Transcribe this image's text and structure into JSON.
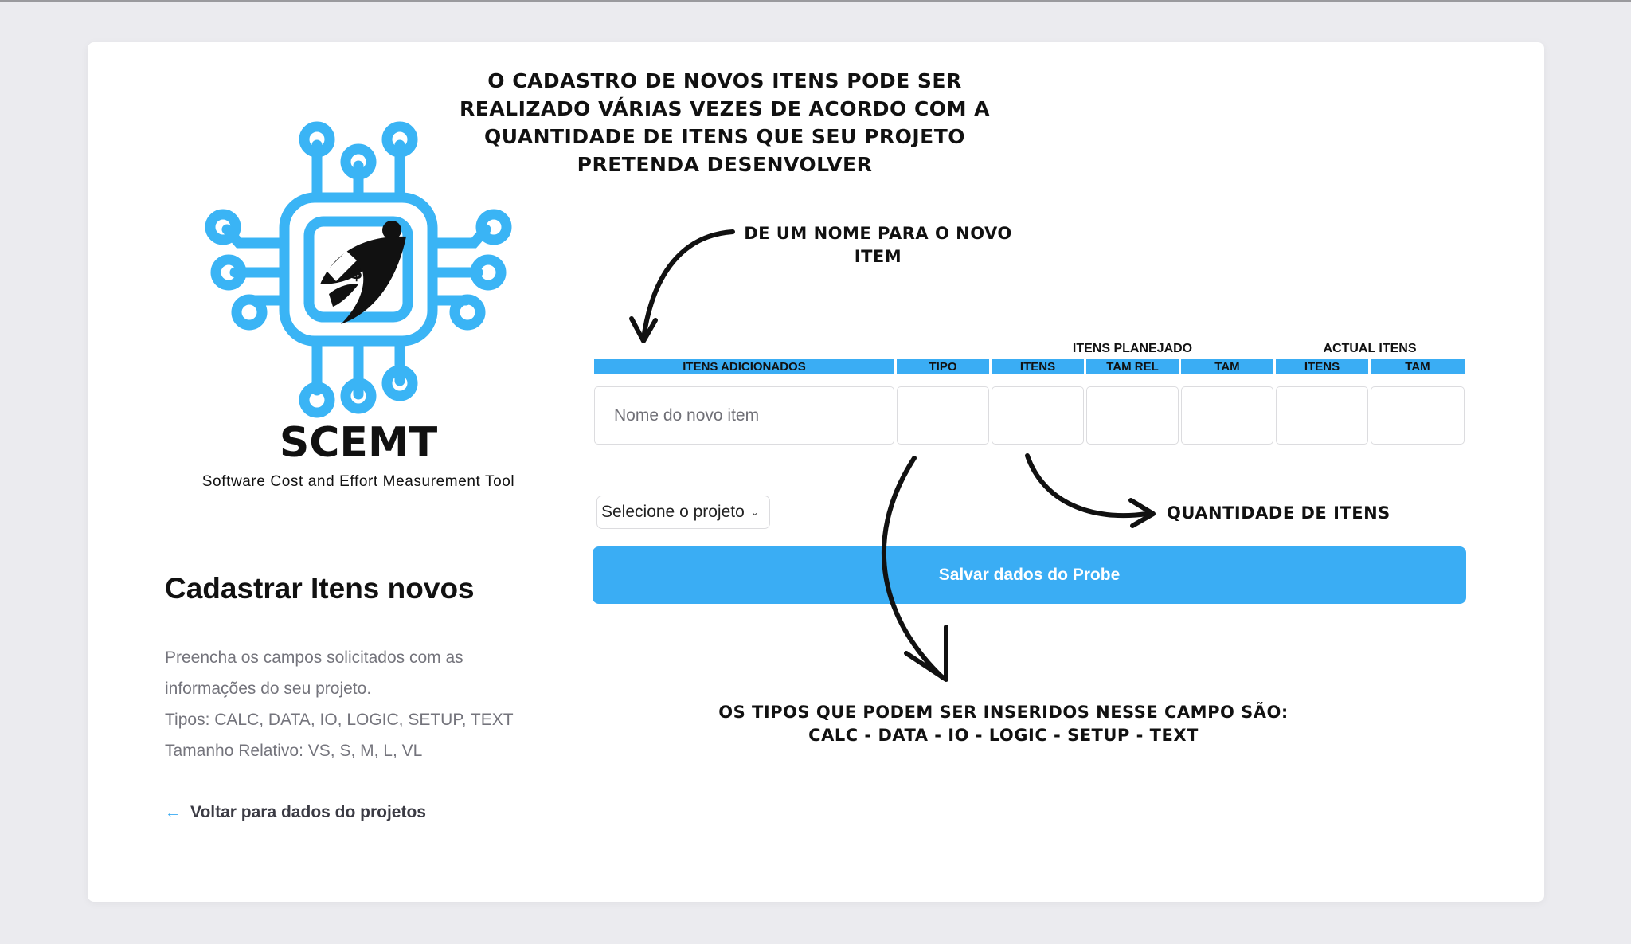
{
  "annotations": {
    "top": "O cadastro de novos itens pode ser realizado várias vezes de acordo com a quantidade de itens que seu projeto pretenda desenvolver",
    "name_hint": "De um nome para o novo item",
    "quantity_hint": "Quantidade de itens",
    "types_hint_line1": "Os tipos que podem ser inseridos nesse campo são:",
    "types_hint_line2": "CALC - DATA - IO - LOGIC - SETUP - TEXT"
  },
  "brand": {
    "title": "SCEMT",
    "subtitle": "Software Cost and Effort Measurement Tool"
  },
  "page": {
    "title": "Cadastrar Itens novos",
    "desc_line1": "Preencha os campos solicitados com as",
    "desc_line2": "informações do seu projeto.",
    "desc_line3": "Tipos: CALC, DATA, IO, LOGIC, SETUP, TEXT",
    "desc_line4": "Tamanho Relativo: VS, S, M, L, VL",
    "back_link": "Voltar para dados do projetos"
  },
  "table": {
    "group_planned": "ITENS PLANEJADO",
    "group_actual": "ACTUAL ITENS",
    "columns": [
      "ITENS ADICIONADOS",
      "TIPO",
      "ITENS",
      "TAM REL",
      "TAM",
      "ITENS",
      "TAM"
    ],
    "name_placeholder": "Nome do novo item"
  },
  "form": {
    "project_select": "Selecione o projeto",
    "save_button": "Salvar dados do Probe"
  },
  "colors": {
    "accent": "#3aadf4",
    "logo_blue": "#3ab4f5",
    "text_muted": "#74747c"
  }
}
